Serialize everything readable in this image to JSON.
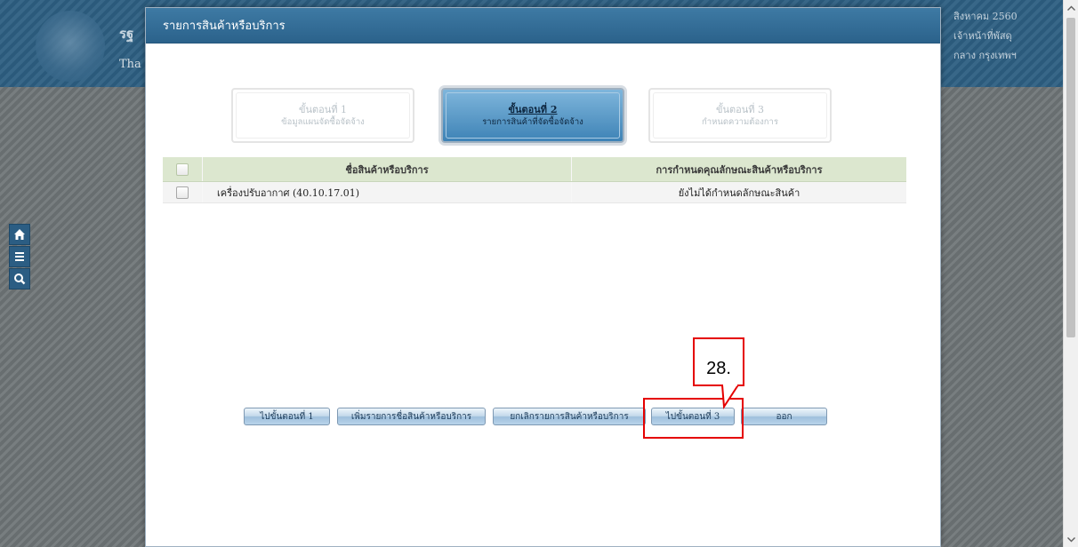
{
  "background": {
    "title_fragment_1": "รฐ",
    "title_fragment_2": "Tha",
    "right_info": [
      "สิงหาคม 2560",
      "เจ้าหน้าที่พัสดุ",
      "กลาง กรุงเทพฯ"
    ]
  },
  "side_toolbar": {
    "icons": [
      "home-icon",
      "menu-icon",
      "search-icon"
    ]
  },
  "modal": {
    "title": "รายการสินค้าหรือบริการ",
    "steps": [
      {
        "title": "ขั้นตอนที่ 1",
        "subtitle": "ข้อมูลแผนจัดซื้อจัดจ้าง",
        "state": "inactive"
      },
      {
        "title": "ขั้นตอนที่ 2",
        "subtitle": "รายการสินค้าที่จัดซื้อจัดจ้าง",
        "state": "active"
      },
      {
        "title": "ขั้นตอนที่ 3",
        "subtitle": "กำหนดความต้องการ",
        "state": "inactive"
      }
    ],
    "table": {
      "columns": [
        "ชื่อสินค้าหรือบริการ",
        "การกำหนดคุณลักษณะสินค้าหรือบริการ"
      ],
      "rows": [
        {
          "name": "เครื่องปรับอากาศ (40.10.17.01)",
          "spec": "ยังไม่ได้กำหนดลักษณะสินค้า"
        }
      ]
    },
    "buttons": {
      "prev_step": "ไปขั้นตอนที่ 1",
      "add_item": "เพิ่มรายการชื่อสินค้าหรือบริการ",
      "cancel_item": "ยกเลิกรายการสินค้าหรือบริการ",
      "next_step": "ไปขั้นตอนที่ 3",
      "exit": "ออก"
    }
  },
  "annotation": {
    "label": "28.",
    "color": "#e50000"
  },
  "colors": {
    "header_blue": "#2b628b",
    "table_header": "#dce7cf",
    "active_step": "#3e83b6"
  }
}
